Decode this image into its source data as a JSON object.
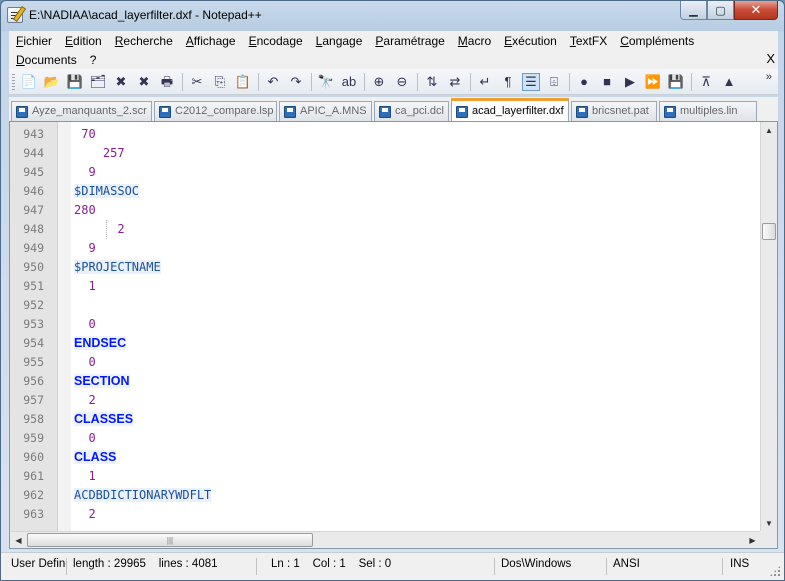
{
  "window": {
    "title": "E:\\NADIAA\\acad_layerfilter.dxf - Notepad++",
    "buttons": {
      "minimize": "▁",
      "maximize": "▢",
      "close": "✕"
    }
  },
  "menu": {
    "row1": [
      "Fichier",
      "Edition",
      "Recherche",
      "Affichage",
      "Encodage",
      "Langage",
      "Paramétrage",
      "Macro",
      "Exécution",
      "TextFX",
      "Compléments"
    ],
    "row2": [
      "Documents",
      "?"
    ],
    "close_label": "X"
  },
  "toolbar": {
    "icons": [
      "new-file",
      "open-file",
      "save",
      "save-all",
      "close",
      "close-all",
      "print",
      "cut",
      "copy",
      "paste",
      "undo",
      "redo",
      "find",
      "replace",
      "zoom-in",
      "zoom-out",
      "sync-vertical",
      "sync-horizontal",
      "word-wrap",
      "show-all-chars",
      "indent-guide",
      "user-defined-lang",
      "record-macro",
      "stop-record",
      "play-macro",
      "run-macro-multiple",
      "save-macro",
      "trim",
      "trim-up"
    ],
    "glyphs": [
      "📄",
      "📂",
      "💾",
      "🗂",
      "✖",
      "✖",
      "🖶",
      "✂",
      "⎘",
      "📋",
      "↶",
      "↷",
      "🔭",
      "ab",
      "⊕",
      "⊖",
      "⇅",
      "⇄",
      "↵",
      "¶",
      "☰",
      "⌹",
      "●",
      "■",
      "▶",
      "⏩",
      "💾",
      "⊼",
      "▲"
    ],
    "more": "»"
  },
  "tabs": [
    {
      "label": "Ayze_manquants_2.scr",
      "active": false
    },
    {
      "label": "C2012_compare.lsp",
      "active": false
    },
    {
      "label": "APIC_A.MNS",
      "active": false
    },
    {
      "label": "ca_pci.dcl",
      "active": false
    },
    {
      "label": "acad_layerfilter.dxf",
      "active": true
    },
    {
      "label": "bricsnet.pat",
      "active": false
    },
    {
      "label": "multiples.lin",
      "active": false
    }
  ],
  "editor": {
    "lines": [
      {
        "n": "943",
        "text": " 70",
        "style": "num"
      },
      {
        "n": "944",
        "text": "    257",
        "style": "num"
      },
      {
        "n": "945",
        "text": "  9",
        "style": "num"
      },
      {
        "n": "946",
        "text": "$DIMASSOC",
        "style": "var"
      },
      {
        "n": "947",
        "text": "280",
        "style": "num"
      },
      {
        "n": "948",
        "text": "      2",
        "style": "num",
        "guide": true
      },
      {
        "n": "949",
        "text": "  9",
        "style": "num"
      },
      {
        "n": "950",
        "text": "$PROJECTNAME",
        "style": "var"
      },
      {
        "n": "951",
        "text": "  1",
        "style": "num"
      },
      {
        "n": "952",
        "text": "",
        "style": "num"
      },
      {
        "n": "953",
        "text": "  0",
        "style": "num"
      },
      {
        "n": "954",
        "text": "ENDSEC",
        "style": "kw"
      },
      {
        "n": "955",
        "text": "  0",
        "style": "num"
      },
      {
        "n": "956",
        "text": "SECTION",
        "style": "kw"
      },
      {
        "n": "957",
        "text": "  2",
        "style": "num"
      },
      {
        "n": "958",
        "text": "CLASSES",
        "style": "kw"
      },
      {
        "n": "959",
        "text": "  0",
        "style": "num"
      },
      {
        "n": "960",
        "text": "CLASS",
        "style": "kw"
      },
      {
        "n": "961",
        "text": "  1",
        "style": "num"
      },
      {
        "n": "962",
        "text": "ACDBDICTIONARYWDFLT",
        "style": "var"
      },
      {
        "n": "963",
        "text": "  2",
        "style": "num"
      }
    ],
    "hscroll_thumb_grip": "|||"
  },
  "statusbar": {
    "lang": "User Define",
    "length": "length : 29965",
    "lines": "lines : 4081",
    "ln": "Ln : 1",
    "col": "Col : 1",
    "sel": "Sel : 0",
    "eol": "Dos\\Windows",
    "encoding": "ANSI",
    "mode": "INS"
  },
  "colors": {
    "number": "#8a1e8c",
    "variable": "#1a4f9c",
    "keyword": "#0018ff",
    "active_tab_accent": "#f0a030"
  }
}
